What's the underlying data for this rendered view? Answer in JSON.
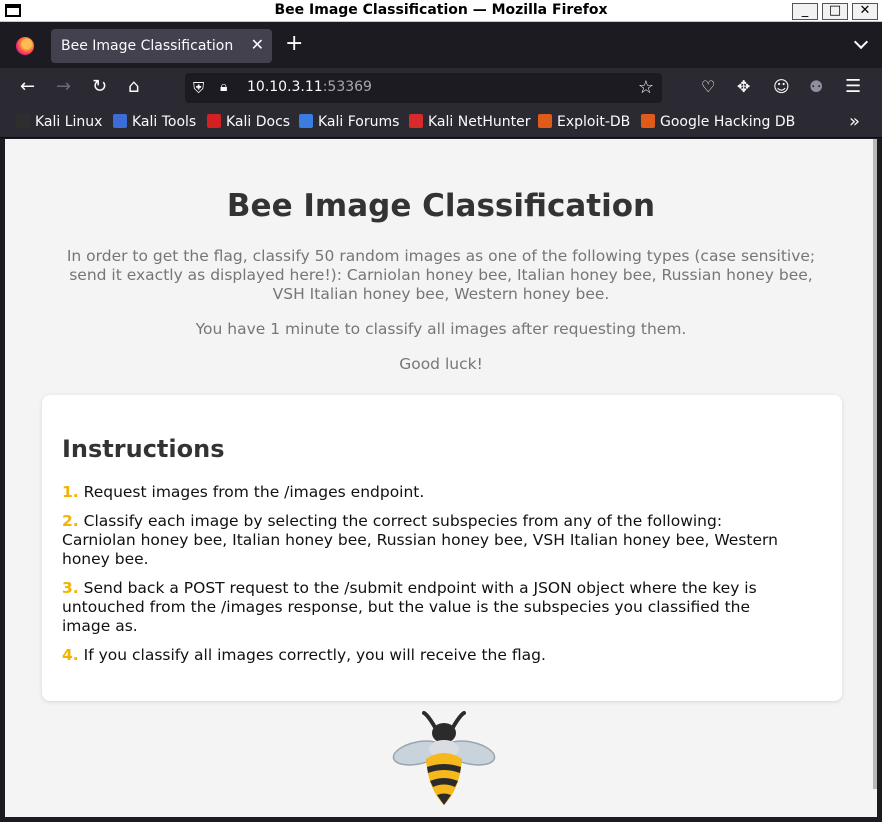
{
  "window": {
    "title": "Bee Image Classification — Mozilla Firefox",
    "buttons": [
      "_",
      "□",
      "✕"
    ]
  },
  "tab": {
    "title": "Bee Image Classification",
    "close": "✕",
    "new_tab": "+"
  },
  "nav": {
    "url_host": "10.10.3.11",
    "url_port": ":53369"
  },
  "bookmarks": [
    {
      "label": "Kali Linux",
      "color": "#2e2e2e"
    },
    {
      "label": "Kali Tools",
      "color": "#3c6cd8"
    },
    {
      "label": "Kali Docs",
      "color": "#d32020"
    },
    {
      "label": "Kali Forums",
      "color": "#3a7ce0"
    },
    {
      "label": "Kali NetHunter",
      "color": "#d82a2a"
    },
    {
      "label": "Exploit-DB",
      "color": "#e05a1a"
    },
    {
      "label": "Google Hacking DB",
      "color": "#e05a1a"
    }
  ],
  "page": {
    "heading": "Bee Image Classification",
    "intro_lines": [
      "In order to get the flag, classify 50 random images as one of the following types (case sensitive;",
      "send it exactly as displayed here!): Carniolan honey bee, Italian honey bee, Russian honey bee,",
      "VSH Italian honey bee, Western honey bee."
    ],
    "time_note": "You have 1 minute to classify all images after requesting them.",
    "luck": "Good luck!",
    "instructions_title": "Instructions",
    "steps": [
      {
        "num": "1.",
        "lines": [
          "Request images from the /images endpoint."
        ]
      },
      {
        "num": "2.",
        "lines": [
          "Classify each image by selecting the correct subspecies from any of the following:",
          "Carniolan honey bee, Italian honey bee, Russian honey bee, VSH Italian honey bee, Western",
          "honey bee."
        ]
      },
      {
        "num": "3.",
        "lines": [
          "Send back a POST request to the /submit endpoint with a JSON object where the key is",
          "untouched from the /images response, but the value is the subspecies you classified the",
          "image as."
        ]
      },
      {
        "num": "4.",
        "lines": [
          "If you classify all images correctly, you will receive the flag."
        ]
      }
    ]
  },
  "colors": {
    "accent": "#f2b400",
    "heading": "#333333",
    "muted": "#767676"
  }
}
